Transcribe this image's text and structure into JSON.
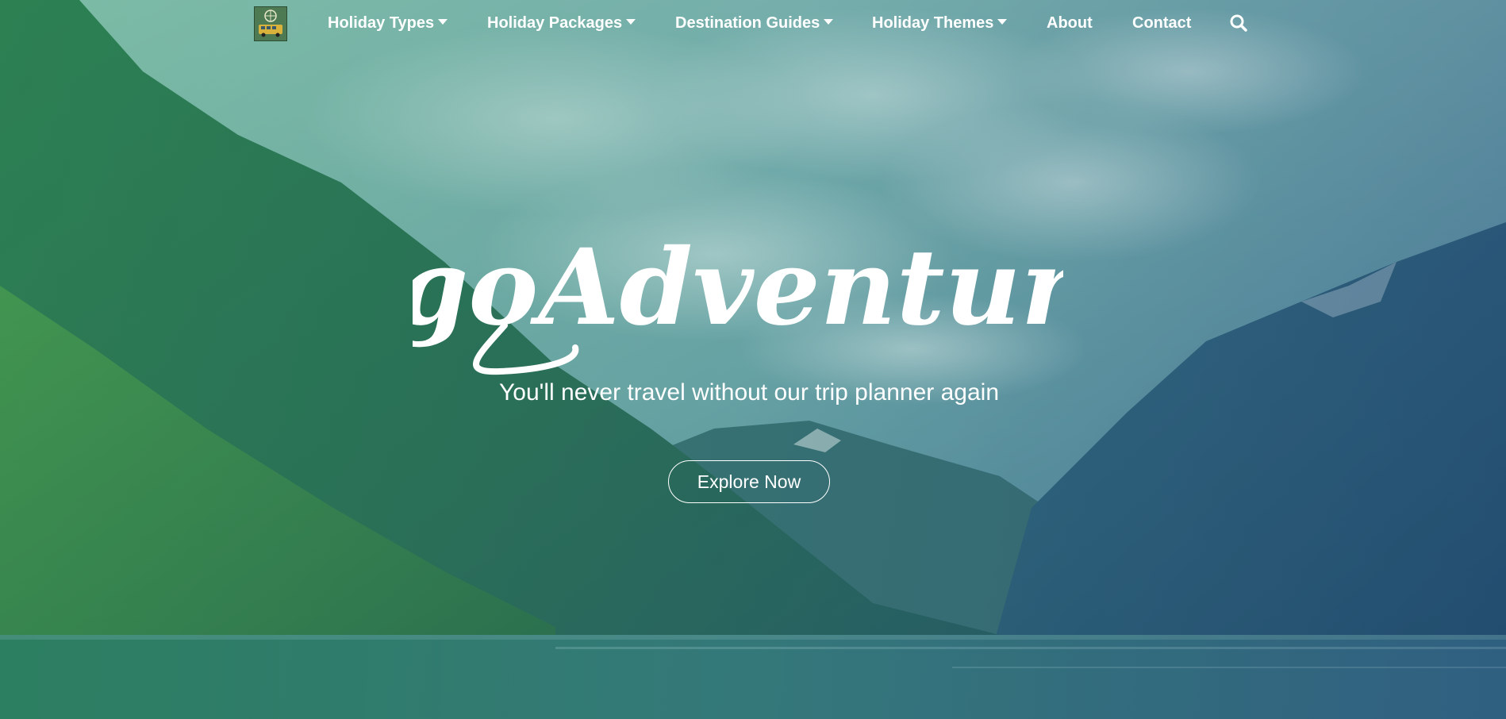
{
  "brand": {
    "name": "AlgoAdventures",
    "logo_icon": "globe-bus-logo-icon",
    "tagline": "You'll never travel without our trip planner again"
  },
  "nav": {
    "items": [
      {
        "label": "Holiday Types",
        "has_dropdown": true
      },
      {
        "label": "Holiday Packages",
        "has_dropdown": true
      },
      {
        "label": "Destination Guides",
        "has_dropdown": true
      },
      {
        "label": "Holiday Themes",
        "has_dropdown": true
      },
      {
        "label": "About",
        "has_dropdown": false
      },
      {
        "label": "Contact",
        "has_dropdown": false
      }
    ],
    "search_icon": "search-icon"
  },
  "hero": {
    "cta_label": "Explore Now",
    "background": "mountain-fjord-landscape",
    "overlay_color": "#2a8c6e"
  },
  "colors": {
    "text": "#ffffff",
    "sky": "#8fc2c3",
    "mountain_left": "#2f7a4a",
    "mountain_right": "#2e5672",
    "water": "#2c6a6e"
  }
}
